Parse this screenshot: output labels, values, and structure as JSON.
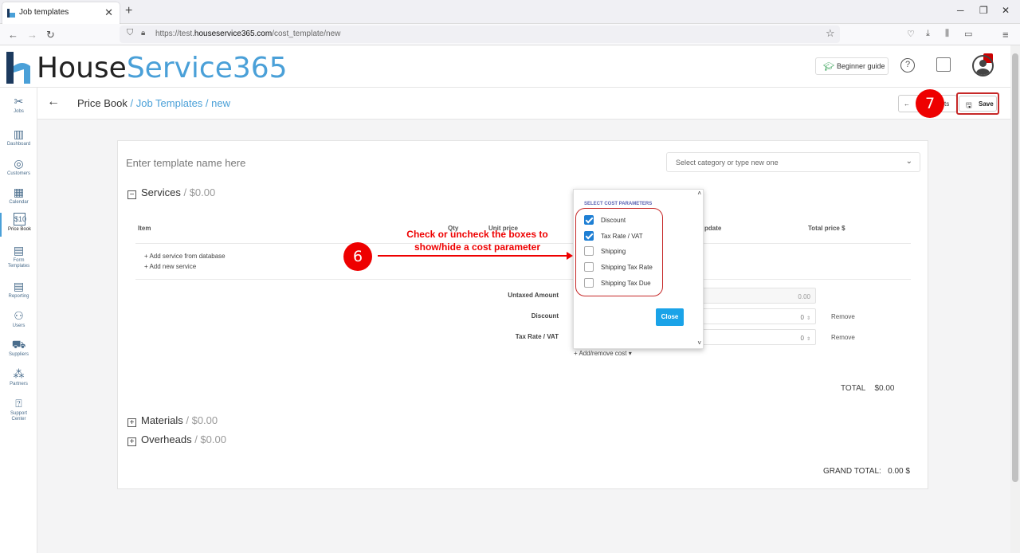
{
  "browser": {
    "tab_title": "Job templates",
    "tab_close": "✕",
    "new_tab": "+",
    "url_prefix": "https://test.",
    "url_domain": "houseservice365.com",
    "url_path": "/cost_template/new"
  },
  "header": {
    "logo_part1": "House",
    "logo_part2": "Service365",
    "beginner_guide": "Beginner guide"
  },
  "sidebar": {
    "items": [
      {
        "label": "Jobs",
        "icon": "tools-icon"
      },
      {
        "label": "Dashboard",
        "icon": "chart-icon"
      },
      {
        "label": "Customers",
        "icon": "target-icon"
      },
      {
        "label": "Calendar",
        "icon": "calendar-icon"
      },
      {
        "label": "Price Book",
        "icon": "price-tag-icon"
      },
      {
        "label": "Form Templates",
        "icon": "form-icon"
      },
      {
        "label": "Reporting",
        "icon": "report-icon"
      },
      {
        "label": "Users",
        "icon": "users-icon"
      },
      {
        "label": "Suppliers",
        "icon": "truck-icon"
      },
      {
        "label": "Partners",
        "icon": "network-icon"
      },
      {
        "label": "Support Center",
        "icon": "help-icon"
      }
    ]
  },
  "page": {
    "crumb_root": "Price Book",
    "crumb_rest": " / Job Templates / new",
    "back_button_suffix": "ts",
    "save": "Save"
  },
  "form": {
    "template_name_placeholder": "Enter template name here",
    "category_placeholder": "Select category or type new one",
    "services_label": "Services",
    "services_amount": " / $0.00",
    "columns": {
      "item": "Item",
      "qty": "Qty",
      "unit_price": "Unit price",
      "update": "pdate",
      "total_price": "Total price $"
    },
    "add_from_db": "+ Add service from database",
    "add_new": "+ Add new service",
    "untaxed_label": "Untaxed Amount",
    "untaxed_value": "0.00",
    "discount_label": "Discount",
    "discount_value": "0",
    "tax_label": "Tax Rate / VAT",
    "tax_value": "0",
    "remove": "Remove",
    "add_remove_cost": "+ Add/remove cost ▾",
    "total_label": "TOTAL",
    "total_value": "$0.00",
    "materials_label": "Materials",
    "materials_amount": " / $0.00",
    "overheads_label": "Overheads",
    "overheads_amount": " / $0.00",
    "grand_total_label": "GRAND TOTAL:",
    "grand_total_value": "0.00 $"
  },
  "popup": {
    "header": "SELECT COST PARAMETERS",
    "options": [
      {
        "label": "Discount",
        "checked": true
      },
      {
        "label": "Tax Rate / VAT",
        "checked": true
      },
      {
        "label": "Shipping",
        "checked": false
      },
      {
        "label": "Shipping Tax Rate",
        "checked": false
      },
      {
        "label": "Shipping Tax Due",
        "checked": false
      }
    ],
    "close": "Close"
  },
  "annotations": {
    "step6": "6",
    "step7": "7",
    "instruction": "Check or uncheck the boxes to show/hide a cost parameter"
  },
  "colors": {
    "accent": "#4aa0d8",
    "annotation": "#e00000",
    "checkbox": "#1e7fd4",
    "close_button": "#1aa3e8"
  }
}
